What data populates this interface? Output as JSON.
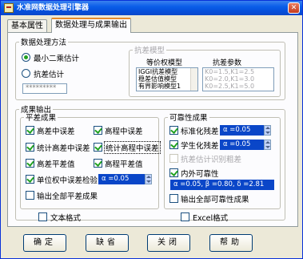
{
  "window": {
    "title": "水准网数据处理引擎器",
    "close_glyph": "✕"
  },
  "tabs": [
    {
      "label": "基本属性"
    },
    {
      "label": "数据处理与成果输出"
    }
  ],
  "data_method": {
    "legend": "数据处理方法",
    "least_squares": "最小二乘估计",
    "robust": "抗差估计",
    "robust_value": "*********"
  },
  "robust_model": {
    "legend": "抗差模型",
    "col_model": "等价权模型",
    "col_params": "抗差参数",
    "models": [
      "IGGI抗差模型",
      "稳差估值模型",
      "有界影响模型1"
    ],
    "params": [
      "K0=1.5,K1=2.5",
      "K0=2.0,K1=3.0",
      "K0=2.5,K1=5.0"
    ]
  },
  "output": {
    "legend": "成果输出",
    "adjust": {
      "legend": "平差成果",
      "items": {
        "elev_rmse": "高差中误差",
        "height_rmse": "高程中误差",
        "stat_elev_rmse": "统计高差中误差",
        "stat_height_rmse": "统计高程中误差",
        "elev_adj": "高差平差值",
        "height_adj": "高程平差值",
        "unit_weight_test": "单位权中误差检验",
        "export_all": "输出全部平差成果"
      },
      "alpha_value": "α =0.05"
    },
    "reliability": {
      "legend": "可靠性成果",
      "items": {
        "std_residual": "标准化残差",
        "student_residual": "学生化残差",
        "robust_identify": "抗差估计识别粗差",
        "inner_outer": "内外可靠性",
        "export_all": "输出全部可靠性成果"
      },
      "std_alpha": "α =0.05",
      "stud_alpha": "α =0.05",
      "inner_outer_value": "α =0.05, β =0.80, δ =2.81"
    },
    "text_format": "文本格式",
    "excel_format": "Excel格式"
  },
  "buttons": {
    "ok": "确定",
    "default": "缺省",
    "close": "关闭",
    "help": "帮助"
  }
}
